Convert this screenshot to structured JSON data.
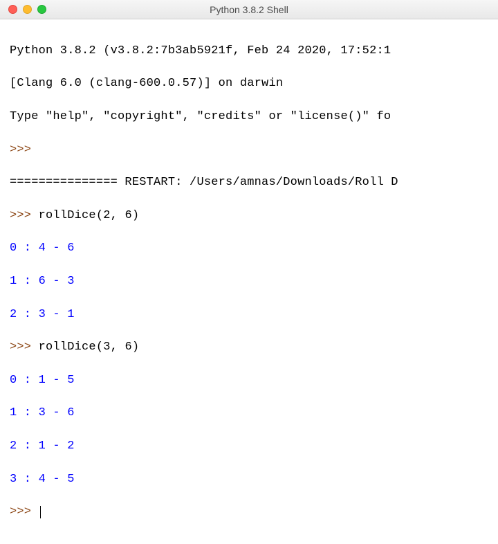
{
  "window": {
    "title": "Python 3.8.2 Shell"
  },
  "terminal": {
    "banner_line1": "Python 3.8.2 (v3.8.2:7b3ab5921f, Feb 24 2020, 17:52:1",
    "banner_line2": "[Clang 6.0 (clang-600.0.57)] on darwin",
    "banner_line3": "Type \"help\", \"copyright\", \"credits\" or \"license()\" fo",
    "prompt": ">>>",
    "restart_line": "=============== RESTART: /Users/amnas/Downloads/Roll D",
    "call1": " rollDice(2, 6)",
    "out1_0": "0 : 4 - 6",
    "out1_1": "1 : 6 - 3",
    "out1_2": "2 : 3 - 1",
    "call2": " rollDice(3, 6)",
    "out2_0": "0 : 1 - 5",
    "out2_1": "1 : 3 - 6",
    "out2_2": "2 : 1 - 2",
    "out2_3": "3 : 4 - 5"
  }
}
